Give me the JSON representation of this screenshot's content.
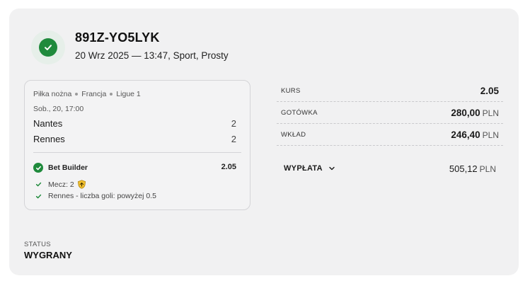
{
  "ticket": {
    "id": "891Z-YO5LYK",
    "meta": "20 Wrz 2025 — 13:47, Sport, Prosty"
  },
  "event": {
    "sport": "Piłka nożna",
    "country": "Francja",
    "league": "Ligue 1",
    "time": "Sob., 20, 17:00",
    "teams": [
      {
        "name": "Nantes",
        "score": "2"
      },
      {
        "name": "Rennes",
        "score": "2"
      }
    ],
    "bet_builder": {
      "label": "Bet Builder",
      "odds": "2.05",
      "selections": [
        "Mecz: 2",
        "Rennes - liczba goli: powyżej 0.5"
      ]
    }
  },
  "summary": {
    "kurs_label": "KURS",
    "kurs_value": "2.05",
    "gotowka_label": "GOTÓWKA",
    "gotowka_value": "280,00",
    "wklad_label": "WKŁAD",
    "wklad_value": "246,40",
    "currency": "PLN",
    "payout_label": "WYPŁATA",
    "payout_value": "505,12"
  },
  "status": {
    "label": "STATUS",
    "value": "WYGRANY"
  },
  "colors": {
    "accent_green": "#1f8a3c",
    "badge_yellow": "#f2c230"
  }
}
